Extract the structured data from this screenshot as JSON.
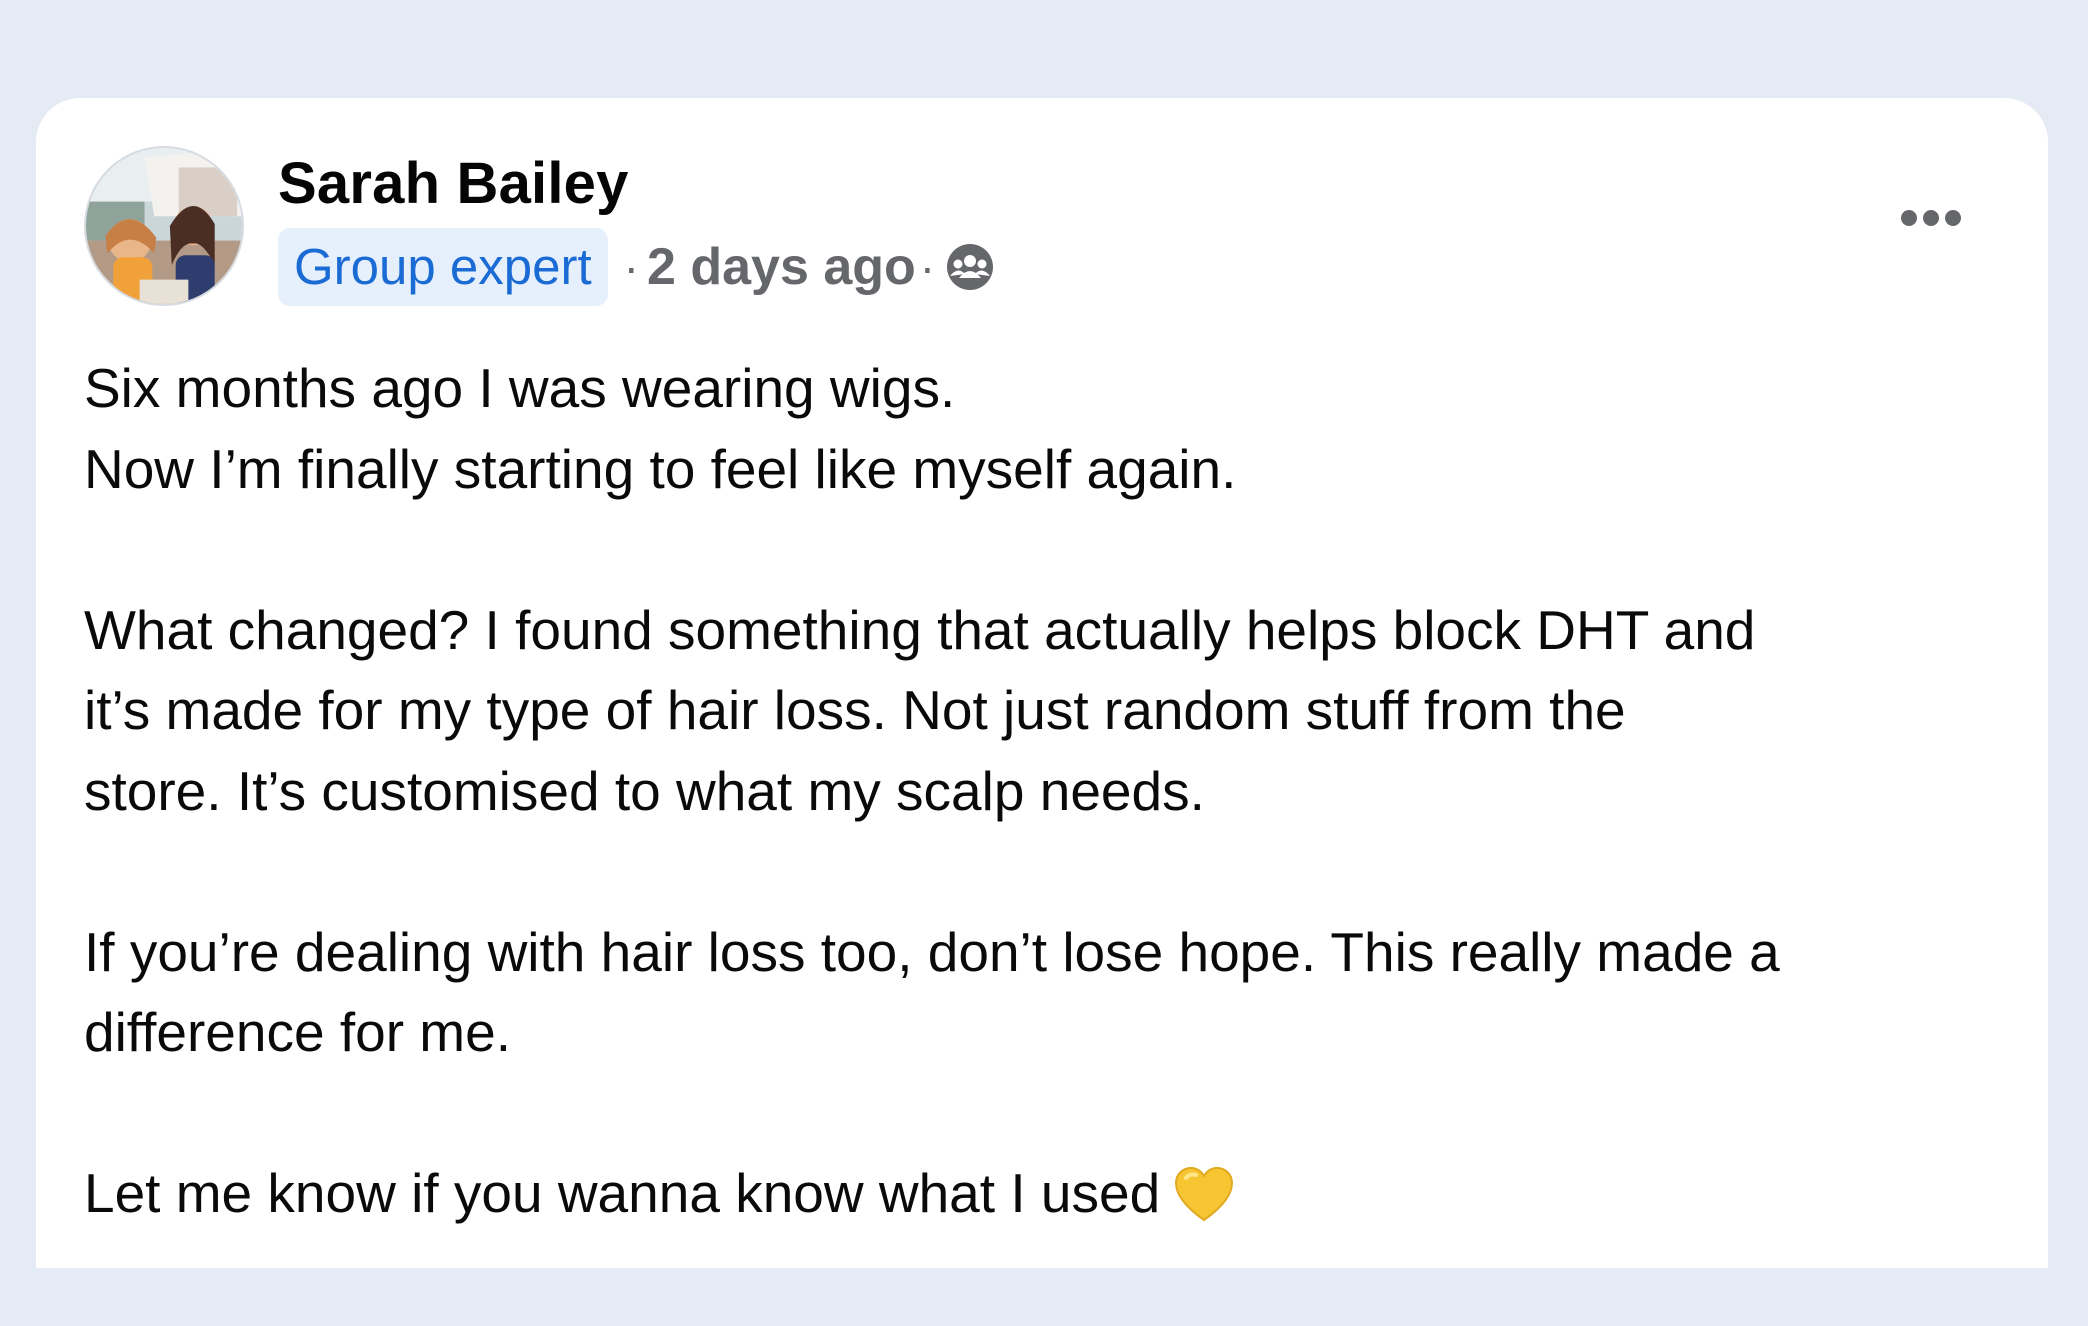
{
  "post": {
    "author": {
      "name": "Sarah Bailey",
      "avatar_icon": "profile-photo-avatar"
    },
    "badge": "Group expert",
    "separator": "·",
    "timestamp": "2 days ago",
    "audience_icon": "group-members-icon",
    "more_icon": "more-options-icon",
    "paragraphs": [
      {
        "lines": [
          "Six months ago I was wearing wigs.",
          "Now I’m finally starting to feel like myself again."
        ]
      },
      {
        "lines": [
          "What changed? I found something that actually helps block DHT and",
          "it’s made for my type of hair loss. Not just random stuff from the",
          "store. It’s customised to what my scalp needs."
        ]
      },
      {
        "lines": [
          "If you’re dealing with hair loss too, don’t lose hope. This really made a",
          "difference for me."
        ]
      },
      {
        "lines": [
          "Let me know if you wanna know what I used"
        ],
        "emoji": "yellow-heart"
      }
    ]
  },
  "colors": {
    "page_background": "#e4ebf4",
    "card_background": "#ffffff",
    "badge_background": "#e6f0fc",
    "badge_text": "#1b6bd4",
    "secondary_text": "#65676b",
    "primary_text": "#0a0a0a",
    "heart": "#f7c531"
  }
}
